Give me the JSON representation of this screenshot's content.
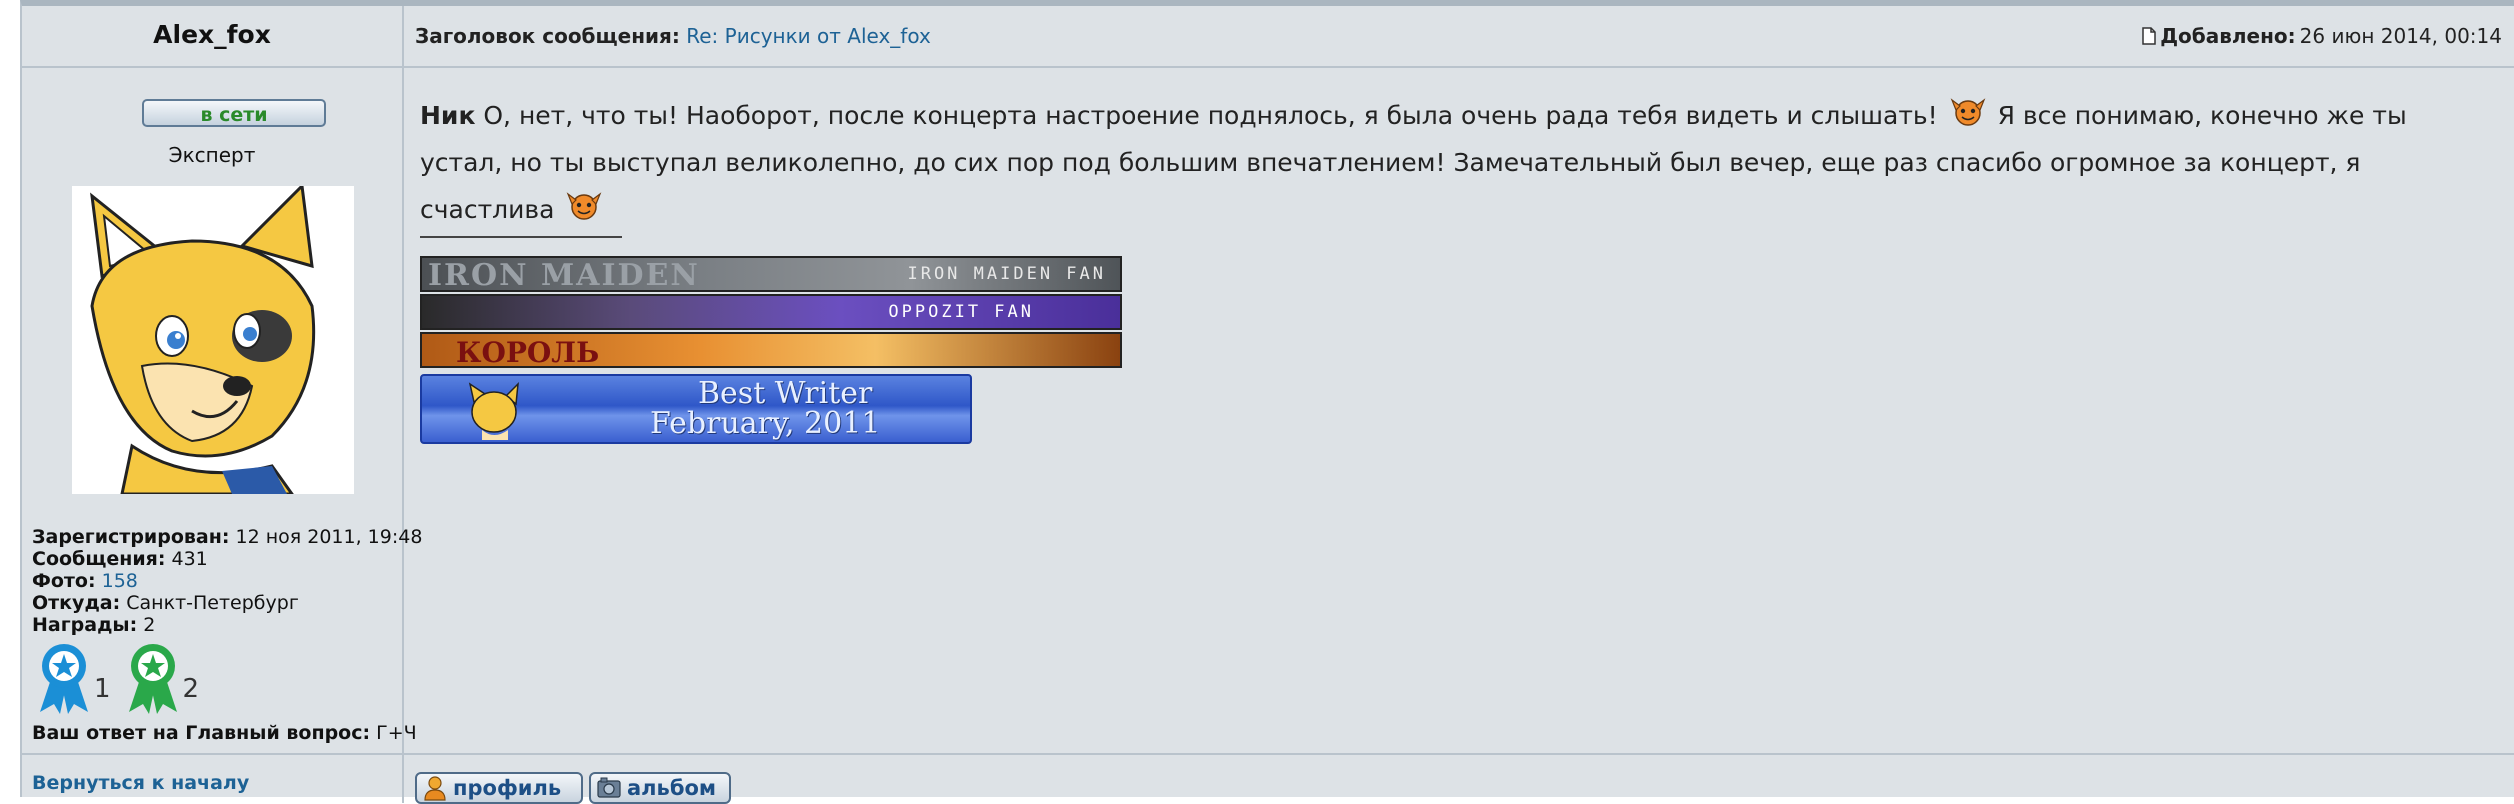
{
  "post": {
    "author": "Alex_fox",
    "subject_label": "Заголовок сообщения:",
    "subject_link": "Re: Рисунки от Alex_fox",
    "added_label": "Добавлено:",
    "added_value": "26 июн 2014, 00:14"
  },
  "profile": {
    "status": "в сети",
    "rank": "Эксперт",
    "registered_label": "Зарегистрирован:",
    "registered_value": "12 ноя 2011, 19:48",
    "messages_label": "Сообщения:",
    "messages_value": "431",
    "photo_label": "Фото:",
    "photo_value": "158",
    "from_label": "Откуда:",
    "from_value": "Санкт-Петербург",
    "awards_label": "Награды:",
    "awards_value": "2",
    "award_counts": [
      "1",
      "2"
    ],
    "answer_label": "Ваш ответ на Главный вопрос:",
    "answer_value": "Г+Ч",
    "back_to_top": "Вернуться к началу"
  },
  "message": {
    "nick": "Ник",
    "text_part1": "О, нет, что ты! Наоборот, после концерта настроение поднялось, я была очень рада тебя видеть и слышать!",
    "text_part2": "Я все понимаю, конечно же ты устал, но ты выступал великолепно, до сих пор под большим впечатлением! Замечательный был вечер, еще раз спасибо огромное за концерт, я счастлива"
  },
  "signature": {
    "banner1_logo": "IRON MAIDEN",
    "banner1_text": "IRON MAIDEN FAN",
    "banner2_text": "OPPOZIT FAN",
    "banner3_logo": "КОРОЛЬ",
    "banner4_line1": "Best Writer",
    "banner4_line2": "February, 2011"
  },
  "actions": {
    "profile": "профиль",
    "album": "альбом"
  },
  "colors": {
    "background": "#dde2e6",
    "border": "#b9c3cc",
    "link": "#1d6295",
    "online": "#2a8a2a"
  },
  "icons": [
    "document-icon",
    "smiley-icon",
    "award-ribbon-icon",
    "profile-icon",
    "album-icon"
  ]
}
